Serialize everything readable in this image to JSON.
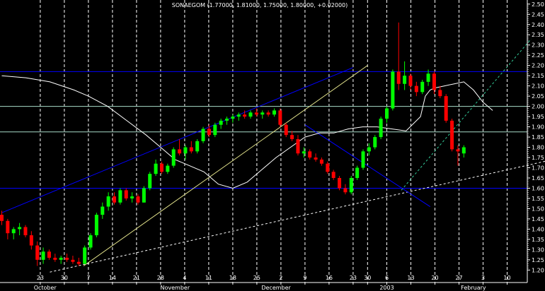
{
  "chart_data": {
    "type": "candlestick",
    "title": "SONAEGOM (1.77000, 1.81000, 1.75000, 1.80000, +0.02000)",
    "ylim": [
      1.17,
      2.52
    ],
    "y_ticks": [
      1.2,
      1.25,
      1.3,
      1.35,
      1.4,
      1.45,
      1.5,
      1.55,
      1.6,
      1.65,
      1.7,
      1.75,
      1.8,
      1.85,
      1.9,
      1.95,
      2.0,
      2.05,
      2.1,
      2.15,
      2.2,
      2.25,
      2.3,
      2.35,
      2.4,
      2.45,
      2.5
    ],
    "x_tick_labels": [
      {
        "i": 8,
        "label": "23"
      },
      {
        "i": 13,
        "label": "30"
      },
      {
        "i": 18,
        "label": "7"
      },
      {
        "i": 23,
        "label": "14"
      },
      {
        "i": 28,
        "label": "21"
      },
      {
        "i": 33,
        "label": "28"
      },
      {
        "i": 38,
        "label": "4"
      },
      {
        "i": 43,
        "label": "11"
      },
      {
        "i": 48,
        "label": "18"
      },
      {
        "i": 53,
        "label": "25"
      },
      {
        "i": 58,
        "label": "2"
      },
      {
        "i": 63,
        "label": "9"
      },
      {
        "i": 68,
        "label": "16"
      },
      {
        "i": 73,
        "label": "23"
      },
      {
        "i": 76,
        "label": "30"
      },
      {
        "i": 80,
        "label": "6"
      },
      {
        "i": 85,
        "label": "13"
      },
      {
        "i": 90,
        "label": "20"
      },
      {
        "i": 95,
        "label": "27"
      },
      {
        "i": 100,
        "label": "3"
      },
      {
        "i": 105,
        "label": "10"
      }
    ],
    "month_labels": [
      {
        "i": 9,
        "label": "October"
      },
      {
        "i": 36,
        "label": "November"
      },
      {
        "i": 57,
        "label": "December"
      },
      {
        "i": 80,
        "label": "2003"
      },
      {
        "i": 98,
        "label": "February"
      }
    ],
    "candles": [
      [
        1.47,
        1.49,
        1.42,
        1.44
      ],
      [
        1.44,
        1.45,
        1.35,
        1.38
      ],
      [
        1.38,
        1.41,
        1.35,
        1.4
      ],
      [
        1.4,
        1.43,
        1.37,
        1.41
      ],
      [
        1.41,
        1.42,
        1.36,
        1.37
      ],
      [
        1.37,
        1.39,
        1.3,
        1.32
      ],
      [
        1.32,
        1.34,
        1.22,
        1.25
      ],
      [
        1.25,
        1.31,
        1.23,
        1.29
      ],
      [
        1.29,
        1.3,
        1.25,
        1.26
      ],
      [
        1.26,
        1.28,
        1.24,
        1.25
      ],
      [
        1.25,
        1.27,
        1.23,
        1.26
      ],
      [
        1.26,
        1.28,
        1.24,
        1.25
      ],
      [
        1.25,
        1.27,
        1.23,
        1.24
      ],
      [
        1.24,
        1.26,
        1.22,
        1.23
      ],
      [
        1.23,
        1.32,
        1.23,
        1.31
      ],
      [
        1.31,
        1.38,
        1.3,
        1.37
      ],
      [
        1.37,
        1.48,
        1.36,
        1.47
      ],
      [
        1.47,
        1.53,
        1.45,
        1.51
      ],
      [
        1.51,
        1.58,
        1.49,
        1.56
      ],
      [
        1.56,
        1.58,
        1.52,
        1.53
      ],
      [
        1.53,
        1.6,
        1.52,
        1.59
      ],
      [
        1.59,
        1.6,
        1.54,
        1.55
      ],
      [
        1.55,
        1.58,
        1.53,
        1.56
      ],
      [
        1.56,
        1.57,
        1.52,
        1.53
      ],
      [
        1.53,
        1.61,
        1.53,
        1.6
      ],
      [
        1.6,
        1.68,
        1.59,
        1.67
      ],
      [
        1.67,
        1.74,
        1.66,
        1.72
      ],
      [
        1.72,
        1.73,
        1.67,
        1.68
      ],
      [
        1.68,
        1.72,
        1.67,
        1.71
      ],
      [
        1.71,
        1.8,
        1.7,
        1.79
      ],
      [
        1.79,
        1.84,
        1.76,
        1.77
      ],
      [
        1.77,
        1.81,
        1.74,
        1.8
      ],
      [
        1.8,
        1.83,
        1.77,
        1.78
      ],
      [
        1.78,
        1.84,
        1.77,
        1.83
      ],
      [
        1.83,
        1.9,
        1.82,
        1.89
      ],
      [
        1.89,
        1.91,
        1.85,
        1.86
      ],
      [
        1.86,
        1.92,
        1.85,
        1.91
      ],
      [
        1.91,
        1.94,
        1.89,
        1.93
      ],
      [
        1.93,
        1.95,
        1.91,
        1.94
      ],
      [
        1.94,
        1.96,
        1.92,
        1.95
      ],
      [
        1.95,
        1.97,
        1.93,
        1.96
      ],
      [
        1.96,
        1.98,
        1.94,
        1.95
      ],
      [
        1.95,
        1.98,
        1.94,
        1.97
      ],
      [
        1.97,
        1.99,
        1.95,
        1.96
      ],
      [
        1.96,
        1.98,
        1.94,
        1.97
      ],
      [
        1.97,
        1.98,
        1.95,
        1.96
      ],
      [
        1.96,
        1.99,
        1.95,
        1.98
      ],
      [
        1.98,
        1.99,
        1.9,
        1.91
      ],
      [
        1.91,
        1.92,
        1.85,
        1.86
      ],
      [
        1.86,
        1.88,
        1.83,
        1.84
      ],
      [
        1.84,
        1.86,
        1.76,
        1.77
      ],
      [
        1.77,
        1.8,
        1.75,
        1.78
      ],
      [
        1.78,
        1.79,
        1.74,
        1.75
      ],
      [
        1.75,
        1.77,
        1.73,
        1.74
      ],
      [
        1.74,
        1.75,
        1.71,
        1.72
      ],
      [
        1.72,
        1.73,
        1.67,
        1.68
      ],
      [
        1.68,
        1.69,
        1.64,
        1.65
      ],
      [
        1.65,
        1.66,
        1.59,
        1.6
      ],
      [
        1.6,
        1.62,
        1.57,
        1.58
      ],
      [
        1.58,
        1.66,
        1.57,
        1.65
      ],
      [
        1.65,
        1.71,
        1.64,
        1.7
      ],
      [
        1.7,
        1.79,
        1.69,
        1.78
      ],
      [
        1.78,
        1.82,
        1.76,
        1.8
      ],
      [
        1.8,
        1.86,
        1.79,
        1.85
      ],
      [
        1.85,
        1.95,
        1.84,
        1.94
      ],
      [
        1.94,
        2.0,
        1.92,
        1.99
      ],
      [
        1.99,
        2.18,
        1.98,
        2.17
      ],
      [
        2.17,
        2.41,
        2.08,
        2.11
      ],
      [
        2.11,
        2.22,
        2.08,
        2.15
      ],
      [
        2.15,
        2.16,
        2.08,
        2.1
      ],
      [
        2.1,
        2.12,
        2.05,
        2.07
      ],
      [
        2.07,
        2.13,
        2.06,
        2.12
      ],
      [
        2.12,
        2.18,
        2.1,
        2.16
      ],
      [
        2.16,
        2.17,
        2.06,
        2.08
      ],
      [
        2.08,
        2.1,
        2.04,
        2.05
      ],
      [
        2.05,
        2.06,
        1.92,
        1.93
      ],
      [
        1.93,
        1.94,
        1.78,
        1.79
      ],
      [
        1.79,
        1.81,
        1.71,
        1.78
      ],
      [
        1.77,
        1.81,
        1.75,
        1.8
      ]
    ],
    "candle_index_start": 0,
    "last_index": 96,
    "moving_average": [
      [
        0,
        2.15
      ],
      [
        5,
        2.14
      ],
      [
        10,
        2.12
      ],
      [
        15,
        2.08
      ],
      [
        18,
        2.05
      ],
      [
        22,
        2.0
      ],
      [
        26,
        1.93
      ],
      [
        30,
        1.86
      ],
      [
        33,
        1.8
      ],
      [
        36,
        1.74
      ],
      [
        39,
        1.71
      ],
      [
        42,
        1.68
      ],
      [
        45,
        1.62
      ],
      [
        48,
        1.6
      ],
      [
        51,
        1.63
      ],
      [
        54,
        1.69
      ],
      [
        57,
        1.75
      ],
      [
        60,
        1.8
      ],
      [
        63,
        1.85
      ],
      [
        66,
        1.87
      ],
      [
        69,
        1.87
      ],
      [
        72,
        1.89
      ],
      [
        75,
        1.9
      ],
      [
        78,
        1.9
      ],
      [
        81,
        1.89
      ],
      [
        84,
        1.88
      ],
      [
        87,
        1.95
      ],
      [
        88,
        2.05
      ],
      [
        89,
        2.08
      ],
      [
        90,
        2.09
      ],
      [
        92,
        2.1
      ],
      [
        94,
        2.11
      ],
      [
        96,
        2.12
      ],
      [
        98,
        2.08
      ],
      [
        100,
        2.02
      ],
      [
        102,
        1.98
      ]
    ],
    "horizontal_lines": [
      {
        "y": 2.17,
        "color": "#0000ff"
      },
      {
        "y": 2.0,
        "color": "#a8dcc8"
      },
      {
        "y": 1.875,
        "color": "#a8dcc8"
      },
      {
        "y": 1.6,
        "color": "#0000ff"
      }
    ],
    "trend_lines": [
      {
        "from": [
          0,
          1.48
        ],
        "to": [
          73,
          2.19
        ],
        "color": "#0000ff",
        "dash": false
      },
      {
        "from": [
          17,
          1.22
        ],
        "to": [
          76,
          2.2
        ],
        "color": "#dddd88",
        "dash": false
      },
      {
        "from": [
          10,
          1.19
        ],
        "to": [
          124,
          1.79
        ],
        "color": "#ffffff",
        "dash": true
      },
      {
        "from": [
          63,
          1.91
        ],
        "to": [
          89,
          1.51
        ],
        "color": "#0000ff",
        "dash": false
      },
      {
        "from": [
          83,
          1.59
        ],
        "to": [
          110,
          2.33
        ],
        "color": "#33cc99",
        "dash": true
      }
    ],
    "colors": {
      "up": "#00ff00",
      "down": "#ff0000",
      "background": "#000000",
      "grid": "#ffffff",
      "moving_average": "#ffffff"
    },
    "grid": true
  }
}
